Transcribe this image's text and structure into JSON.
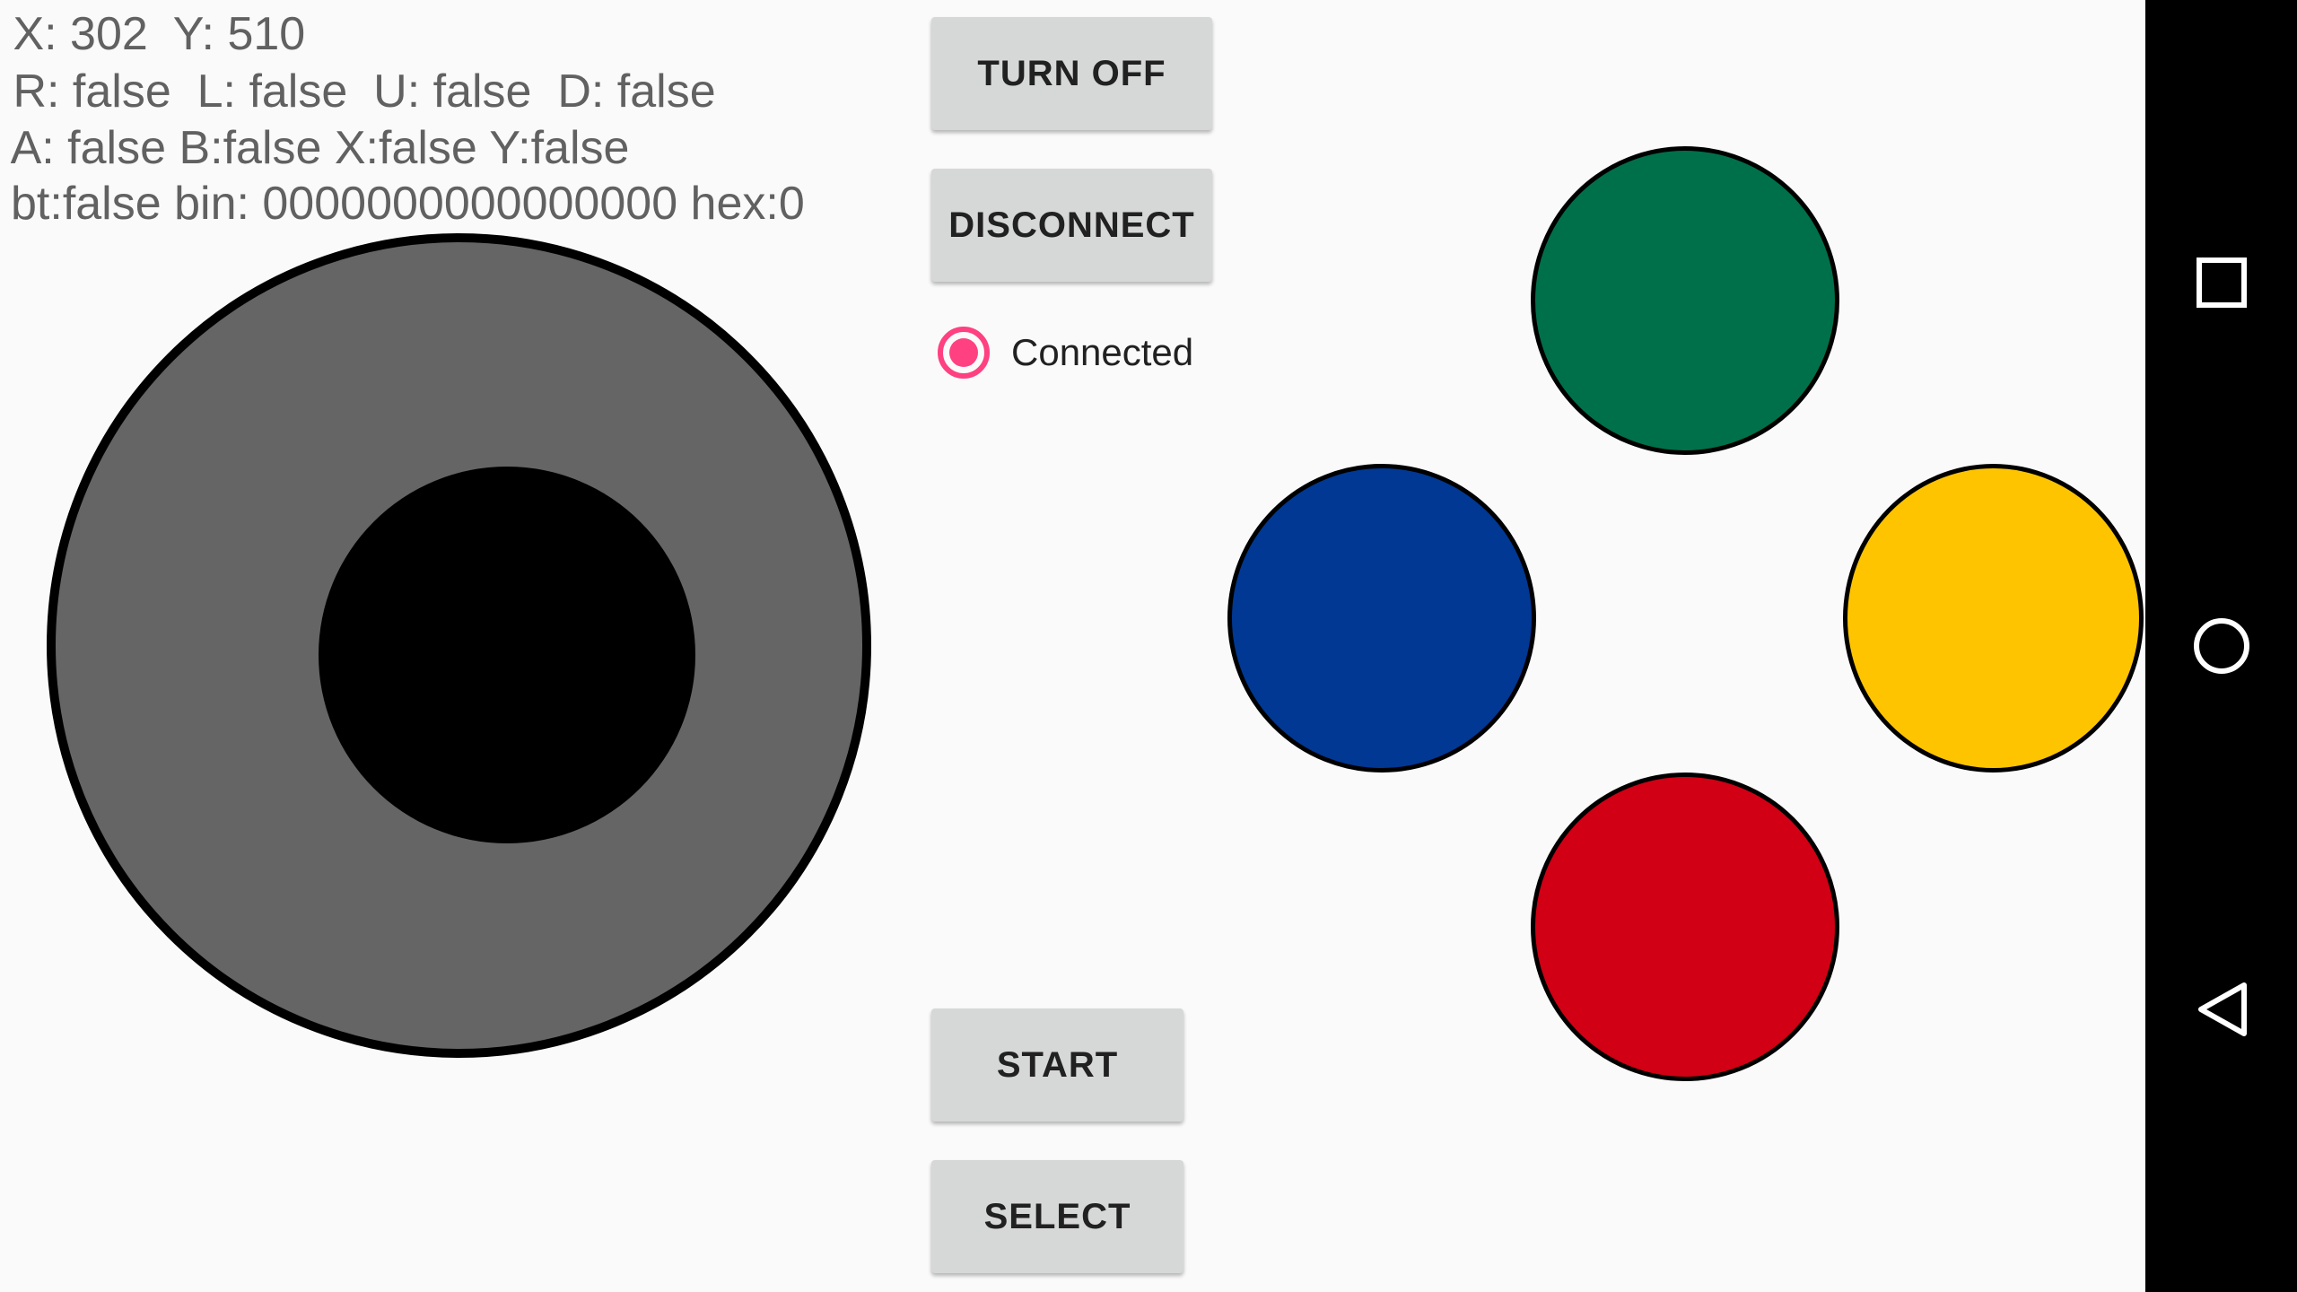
{
  "status": {
    "line1": " X: 302  Y: 510",
    "line2": " R: false  L: false  U: false  D: false",
    "line3": " A: false B:false X:false Y:false",
    "line4": "bt:false bin: 0000000000000000 hex:0"
  },
  "controls": {
    "turn_off_label": "TURN OFF",
    "disconnect_label": "DISCONNECT",
    "start_label": "START",
    "select_label": "SELECT",
    "connected_label": "Connected",
    "connected_checked": true
  },
  "face_buttons": {
    "top_color": "#00704a",
    "left_color": "#003893",
    "right_color": "#ffc400",
    "bottom_color": "#d10014"
  },
  "colors": {
    "accent": "#ff4081",
    "joystick_base": "#656565",
    "joystick_knob": "#000000",
    "button_bg": "#d6d7d7"
  },
  "navbar": {
    "recents_icon": "square-recents-icon",
    "home_icon": "circle-home-icon",
    "back_icon": "triangle-back-icon"
  }
}
